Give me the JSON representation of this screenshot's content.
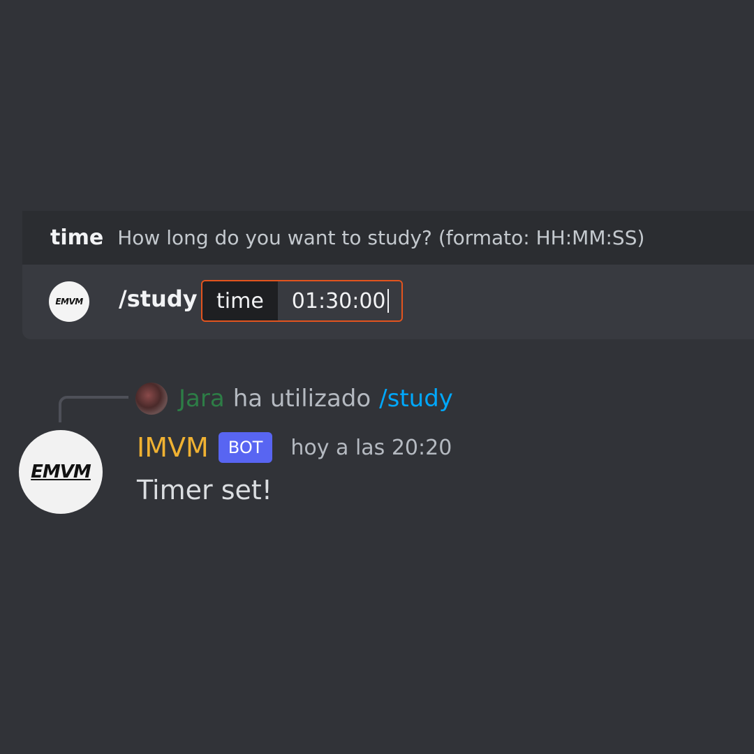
{
  "option_hint": {
    "name": "time",
    "description": "How long do you want to study? (formato: HH:MM:SS)"
  },
  "command_bar": {
    "avatar_logo": "EMVM",
    "command": "/study",
    "option_label": "time",
    "option_value": "01:30:00"
  },
  "message": {
    "reply": {
      "user": "Jara",
      "text": "ha utilizado",
      "command": "/study"
    },
    "avatar_logo": "EMVM",
    "author": "IMVM",
    "bot_tag": "BOT",
    "timestamp": "hoy a las 20:20",
    "content": "Timer set!"
  },
  "colors": {
    "background": "#313338",
    "accent_border": "#e3541e",
    "author": "#f0b232",
    "reply_user": "#2d7d46",
    "command_link": "#00a8fc",
    "bot_tag": "#5865f2"
  }
}
